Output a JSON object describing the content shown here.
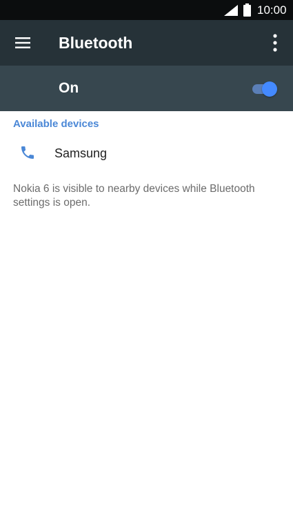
{
  "status_bar": {
    "time": "10:00",
    "icons": [
      "signal-icon",
      "battery-icon"
    ]
  },
  "app_bar": {
    "title": "Bluetooth",
    "menu_icon": "hamburger-menu-icon",
    "overflow_icon": "more-vert-icon"
  },
  "master_switch": {
    "label": "On",
    "state": true,
    "accent_color": "#448aff"
  },
  "available_devices": {
    "header": "Available devices",
    "items": [
      {
        "name": "Samsung",
        "icon": "phone-icon"
      }
    ]
  },
  "footer_note": "Nokia 6 is visible to nearby devices while Bluetooth settings is open.",
  "colors": {
    "app_bar": "#263238",
    "switch_bar": "#37474f",
    "status_bar": "#0b0d0e",
    "accent": "#4a87d6"
  }
}
